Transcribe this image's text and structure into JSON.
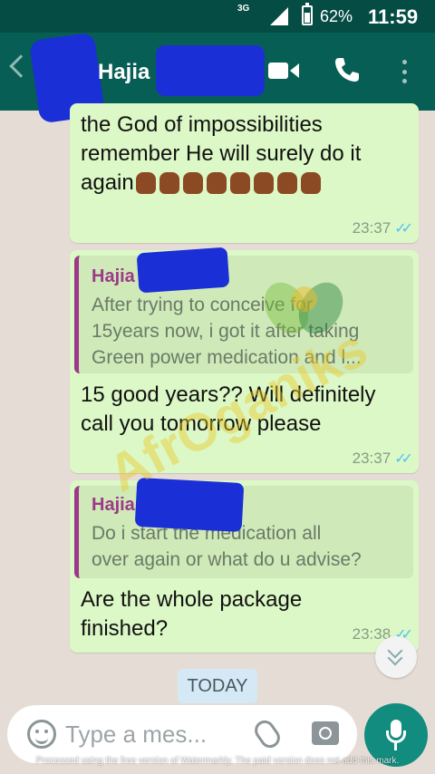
{
  "status_bar": {
    "network": "3G",
    "battery_percent": "62%",
    "battery_level": 0.62,
    "time": "11:59"
  },
  "header": {
    "contact_name": "Hajia"
  },
  "messages": [
    {
      "text_lines": [
        "the God of impossibilities",
        "remember He will surely do it",
        "again"
      ],
      "time": "23:37",
      "status": "read"
    },
    {
      "quote_author": "Hajia",
      "quote_lines": [
        "After trying to conceive for",
        "15years now,  i got it after taking",
        "Green power medication and l..."
      ],
      "text_lines": [
        "15 good years?? Will definitely",
        "call you tomorrow please"
      ],
      "time": "23:37",
      "status": "read"
    },
    {
      "quote_author": "Hajia",
      "quote_lines": [
        "Do i start the medication all",
        "over again or what do u advise?"
      ],
      "text_lines": [
        "Are the whole package",
        "finished?"
      ],
      "time": "23:38",
      "status": "read"
    }
  ],
  "date_chip": "TODAY",
  "composer": {
    "placeholder": "Type a mes..."
  },
  "watermark_text": "AfrOganiks",
  "footer_note": "Processed using the free version of Watermarkly. The paid version does not add this mark.",
  "colors": {
    "header": "#075e54",
    "status_bar": "#054d44",
    "outgoing_bubble": "#dcf8c6",
    "read_ticks": "#4fc3f7",
    "quote_author": "#9c3a88",
    "fab": "#128c7e"
  }
}
